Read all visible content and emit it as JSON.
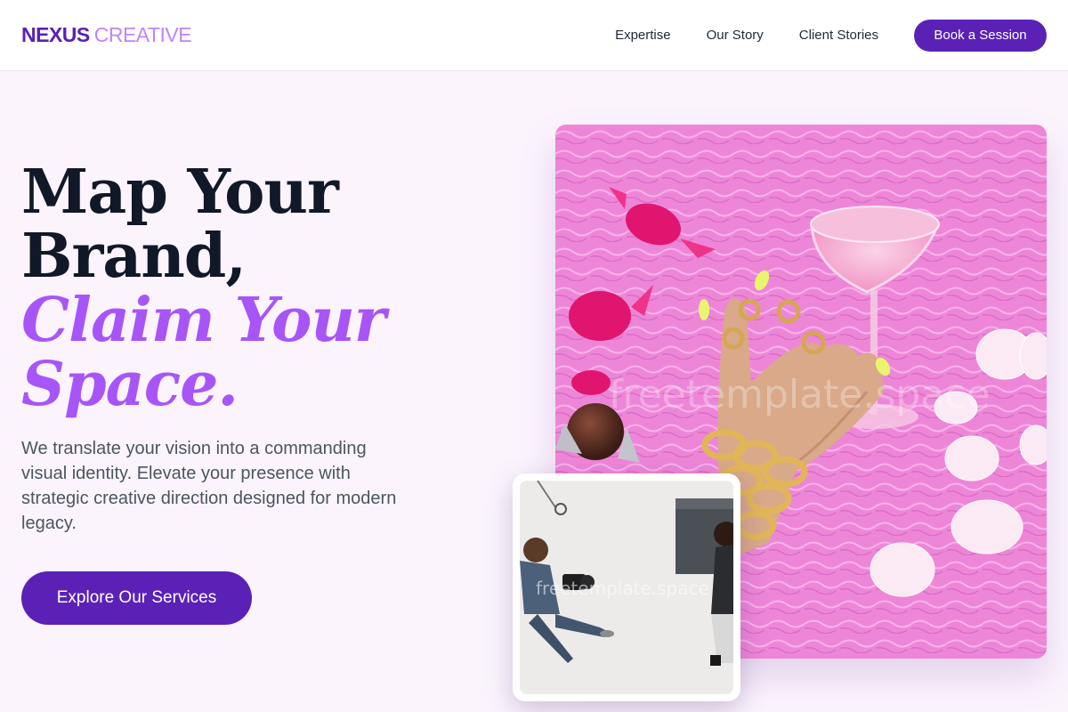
{
  "navbar": {
    "logo_primary": "NEXUS",
    "logo_secondary": "CREATIVE",
    "links": [
      {
        "label": "Expertise"
      },
      {
        "label": "Our Story"
      },
      {
        "label": "Client Stories"
      }
    ],
    "cta_label": "Book a Session"
  },
  "hero": {
    "title_line1": "Map Your",
    "title_line2": "Brand,",
    "title_accent1": "Claim Your",
    "title_accent2": "Space.",
    "subtitle": "We translate your vision into a commanding visual identity. Elevate your presence with strategic creative direction designed for modern legacy.",
    "cta_label": "Explore Our Services"
  },
  "images": {
    "watermark": "freetemplate.space"
  },
  "colors": {
    "brand": "#5b21b6",
    "accent": "#a855f7",
    "background": "#fbf4fd"
  }
}
